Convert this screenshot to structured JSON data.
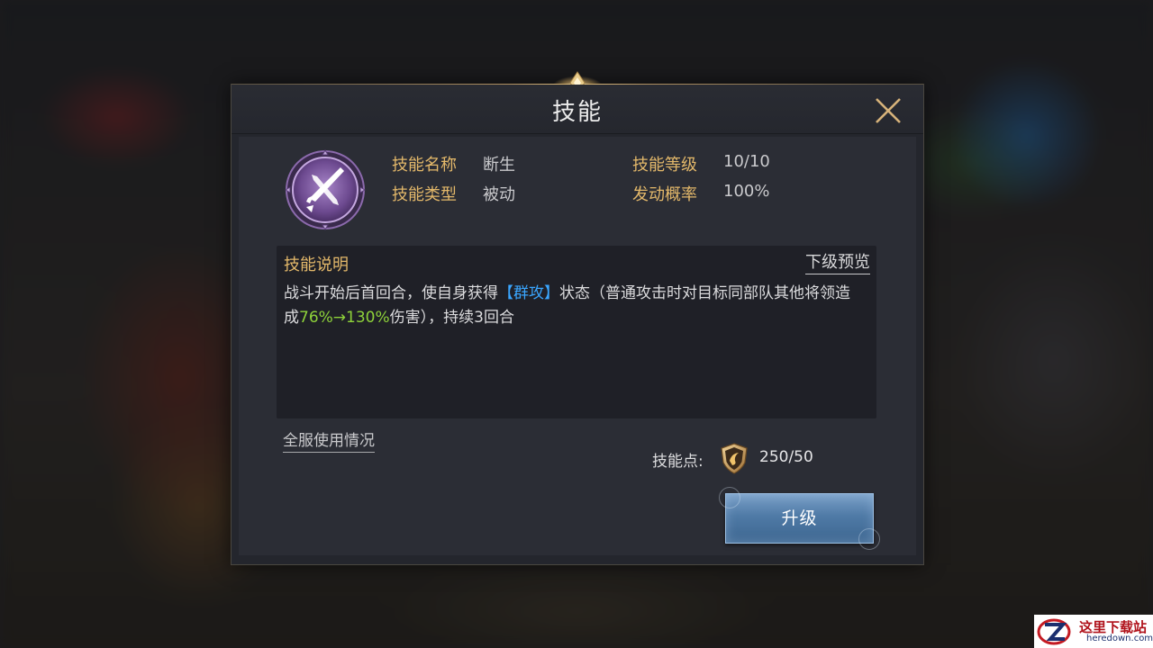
{
  "dialog": {
    "title": "技能",
    "close_icon": "close-x-icon"
  },
  "skill": {
    "icon": "crossed-swords-icon",
    "name_label": "技能名称",
    "name_value": "断生",
    "type_label": "技能类型",
    "type_value": "被动",
    "level_label": "技能等级",
    "level_value": "10/10",
    "rate_label": "发动概率",
    "rate_value": "100%"
  },
  "description": {
    "title": "技能说明",
    "next_preview": "下级预览",
    "text_part1": "战斗开始后首回合，使自身获得",
    "keyword": "【群攻】",
    "text_part2": "状态（普通攻击时对目标同部队其他将领造成",
    "values": "76%→130%",
    "text_part3": "伤害），持续3回合"
  },
  "footer": {
    "usage_link": "全服使用情况",
    "points_label": "技能点:",
    "points_icon": "shield-emblem-icon",
    "points_value": "250/50",
    "upgrade_button": "升级"
  },
  "watermark": {
    "cn": "这里下载站",
    "en": "heredown.com"
  },
  "colors": {
    "label_gold": "#e3b86a",
    "keyword_blue": "#3aa6ff",
    "value_green": "#8ed23a",
    "button_blue": "#4f7aa6"
  }
}
